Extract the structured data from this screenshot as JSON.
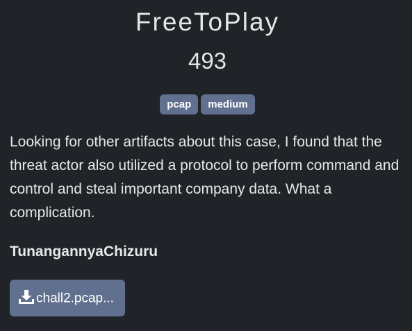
{
  "challenge": {
    "title": "FreeToPlay",
    "points": "493",
    "tags": [
      "pcap",
      "medium"
    ],
    "description": "Looking for other artifacts about this case, I found that the threat actor also utilized a protocol to perform command and control and steal important company data. What a complication.",
    "author": "TunangannyaChizuru",
    "file": {
      "name": "chall2.pcap...",
      "icon": "download-icon"
    }
  },
  "colors": {
    "background": "#202328",
    "tag": "#61708f",
    "text": "#e6e8eb"
  }
}
